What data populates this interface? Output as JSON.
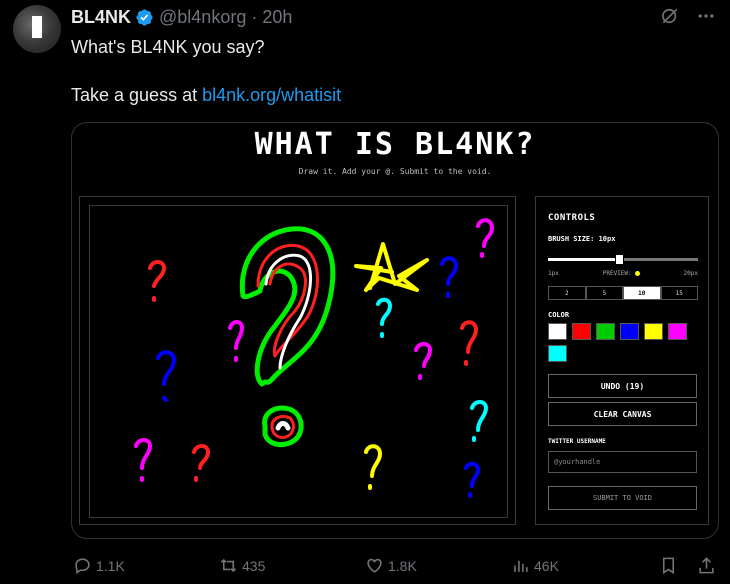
{
  "tweet": {
    "author_name": "BL4NK",
    "handle": "@bl4nkorg",
    "separator": "·",
    "time": "20h",
    "text_line1": "What's BL4NK you say?",
    "text_line2_prefix": "Take a guess at ",
    "link_text": "bl4nk.org/whatisit"
  },
  "card": {
    "title": "WHAT IS BL4NK?",
    "subtitle": "Draw it. Add your @. Submit to the void.",
    "controls": {
      "title": "CONTROLS",
      "brush_label": "BRUSH SIZE: 10px",
      "brush_value": 10,
      "slider_min_label": "1px",
      "preview_label": "PREVIEW:",
      "slider_max_label": "20px",
      "sizes": [
        "2",
        "5",
        "10",
        "15"
      ],
      "active_size": "10",
      "color_label": "COLOR",
      "colors": [
        "#ffffff",
        "#ff0000",
        "#00cc00",
        "#0000ff",
        "#ffff00",
        "#ff00ff",
        "#00ffff"
      ],
      "undo_label": "UNDO (19)",
      "clear_label": "CLEAR CANVAS",
      "twitter_label": "TWITTER USERNAME",
      "username_placeholder": "@yourhandle",
      "submit_label": "SUBMIT TO VOID"
    }
  },
  "actions": {
    "replies": "1.1K",
    "retweets": "435",
    "likes": "1.8K",
    "views": "46K"
  },
  "colors": {
    "link": "#1d9bf0",
    "verified": "#1d9bf0",
    "muted": "#71767b"
  }
}
